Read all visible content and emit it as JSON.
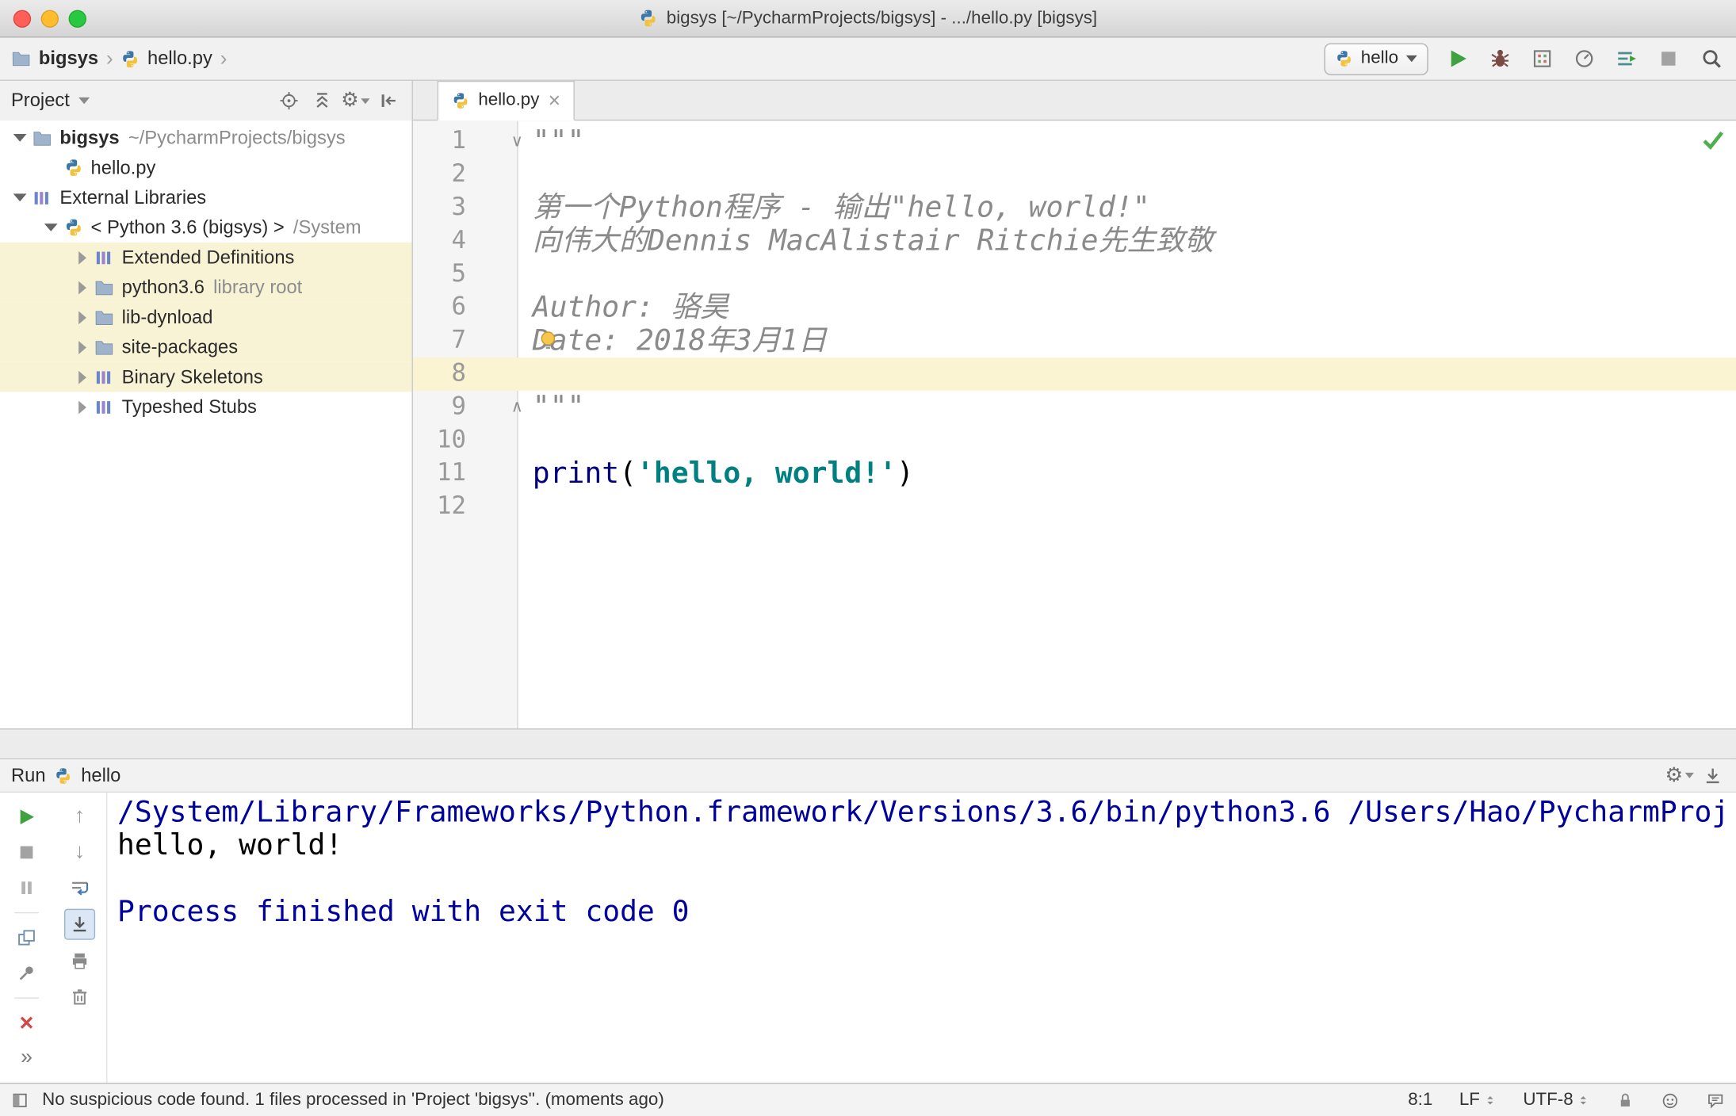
{
  "window": {
    "title": "bigsys [~/PycharmProjects/bigsys] - .../hello.py [bigsys]"
  },
  "breadcrumb": {
    "project": "bigsys",
    "file": "hello.py"
  },
  "run_config": {
    "name": "hello"
  },
  "navbar_actions": [
    "run",
    "debug",
    "coverage",
    "profiler",
    "concurrency",
    "stop"
  ],
  "project": {
    "header": "Project",
    "tree": [
      {
        "depth": 0,
        "arrow": "down",
        "icon": "folder",
        "label": "bigsys",
        "bold": true,
        "suffix": "~/PycharmProjects/bigsys",
        "selected": false
      },
      {
        "depth": 1,
        "arrow": null,
        "icon": "python",
        "label": "hello.py",
        "selected": false
      },
      {
        "depth": 0,
        "arrow": "down",
        "icon": "library",
        "label": "External Libraries",
        "selected": false
      },
      {
        "depth": 1,
        "arrow": "down",
        "icon": "python",
        "label": "< Python 3.6 (bigsys) >",
        "suffix": "/System",
        "selected": false
      },
      {
        "depth": 2,
        "arrow": "right",
        "icon": "library",
        "label": "Extended Definitions",
        "selected": true
      },
      {
        "depth": 2,
        "arrow": "right",
        "icon": "folder",
        "label": "python3.6",
        "suffix": "library root",
        "selected": true
      },
      {
        "depth": 2,
        "arrow": "right",
        "icon": "folder",
        "label": "lib-dynload",
        "selected": true
      },
      {
        "depth": 2,
        "arrow": "right",
        "icon": "folder",
        "label": "site-packages",
        "selected": true
      },
      {
        "depth": 2,
        "arrow": "right",
        "icon": "library",
        "label": "Binary Skeletons",
        "selected": true
      },
      {
        "depth": 2,
        "arrow": "right",
        "icon": "library",
        "label": "Typeshed Stubs",
        "selected": false
      }
    ]
  },
  "editor": {
    "tab": "hello.py",
    "lines": [
      {
        "n": 1,
        "fold": "top",
        "segs": [
          {
            "t": "\"\"\"",
            "c": "doc"
          }
        ]
      },
      {
        "n": 2,
        "segs": []
      },
      {
        "n": 3,
        "segs": [
          {
            "t": "第一个Python程序 - 输出\"hello, world!\"",
            "c": "doc"
          }
        ]
      },
      {
        "n": 4,
        "segs": [
          {
            "t": "向伟大的Dennis MacAlistair Ritchie先生致敬",
            "c": "doc"
          }
        ]
      },
      {
        "n": 5,
        "segs": []
      },
      {
        "n": 6,
        "segs": [
          {
            "t": "Author: 骆昊",
            "c": "doc"
          }
        ]
      },
      {
        "n": 7,
        "bulb": true,
        "segs": [
          {
            "t": "Date: 2018年3月1日",
            "c": "doc"
          }
        ]
      },
      {
        "n": 8,
        "current": true,
        "segs": []
      },
      {
        "n": 9,
        "fold": "bottom",
        "segs": [
          {
            "t": "\"\"\"",
            "c": "doc"
          }
        ]
      },
      {
        "n": 10,
        "segs": []
      },
      {
        "n": 11,
        "segs": [
          {
            "t": "print",
            "c": "kw"
          },
          {
            "t": "(",
            "c": "plain"
          },
          {
            "t": "'hello, world!'",
            "c": "str"
          },
          {
            "t": ")",
            "c": "plain"
          }
        ]
      },
      {
        "n": 12,
        "segs": []
      }
    ]
  },
  "run": {
    "title": "Run",
    "config": "hello",
    "left_toolbar": [
      "rerun",
      "stop",
      "pause",
      "sep",
      "restore-layout",
      "pin",
      "sep",
      "close",
      "more"
    ],
    "right_toolbar": [
      {
        "icon": "up-stack"
      },
      {
        "icon": "down-stack"
      },
      {
        "icon": "soft-wrap"
      },
      {
        "icon": "scroll-end",
        "toggled": true
      },
      {
        "icon": "print"
      },
      {
        "icon": "clear"
      }
    ],
    "console": [
      {
        "c": "sys",
        "text": "/System/Library/Frameworks/Python.framework/Versions/3.6/bin/python3.6 /Users/Hao/PycharmProj"
      },
      {
        "c": "out",
        "text": "hello, world!"
      },
      {
        "c": "out",
        "text": ""
      },
      {
        "c": "sys",
        "text": "Process finished with exit code 0"
      }
    ]
  },
  "status": {
    "message": "No suspicious code found. 1 files processed in 'Project 'bigsys''. (moments ago)",
    "position": "8:1",
    "line_ending": "LF",
    "encoding": "UTF-8"
  },
  "colors": {
    "keyword": "#000080",
    "string": "#008080",
    "docstring": "#8a8a8a",
    "console_system": "#00009c",
    "current_line_highlight": "#fbf4d2",
    "tree_selection": "#f8f3d5",
    "run_button_green": "#3fa13f"
  }
}
